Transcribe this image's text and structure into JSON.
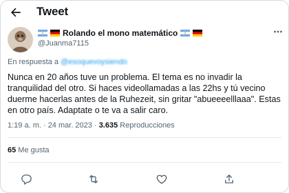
{
  "header": {
    "title": "Tweet",
    "back_icon": "arrow-left-icon"
  },
  "author": {
    "name": "Rolando el mono matemático",
    "handle": "@Juanma7115",
    "flags": [
      "argentina-flag-icon",
      "germany-flag-icon",
      "argentina-flag-icon",
      "germany-flag-icon"
    ]
  },
  "reply": {
    "prefix": "En respuesta a",
    "mention": "@esoquevoysiendo"
  },
  "tweet": {
    "text": "Nunca en 20 años tuve un problema. El tema es no invadir la tranquilidad del otro.  Si haces videollamadas a las 22hs y tú vecino duerme hacerlas antes de la Ruhezeit, sin gritar \"abueeeelllaaa\". Estas en otro país. Adaptate o te va a salir caro."
  },
  "meta": {
    "datetime": "1:19 a. m. · 24 mar. 2023 · ",
    "views_count": "3.635",
    "views_label": " Reproducciones"
  },
  "stats": {
    "likes_count": "65",
    "likes_label": " Me gusta"
  },
  "actions": [
    "reply-icon",
    "retweet-icon",
    "like-icon",
    "share-icon"
  ],
  "colors": {
    "accent": "#1d9bf0",
    "secondary_text": "#536471",
    "text": "#0f1419"
  }
}
